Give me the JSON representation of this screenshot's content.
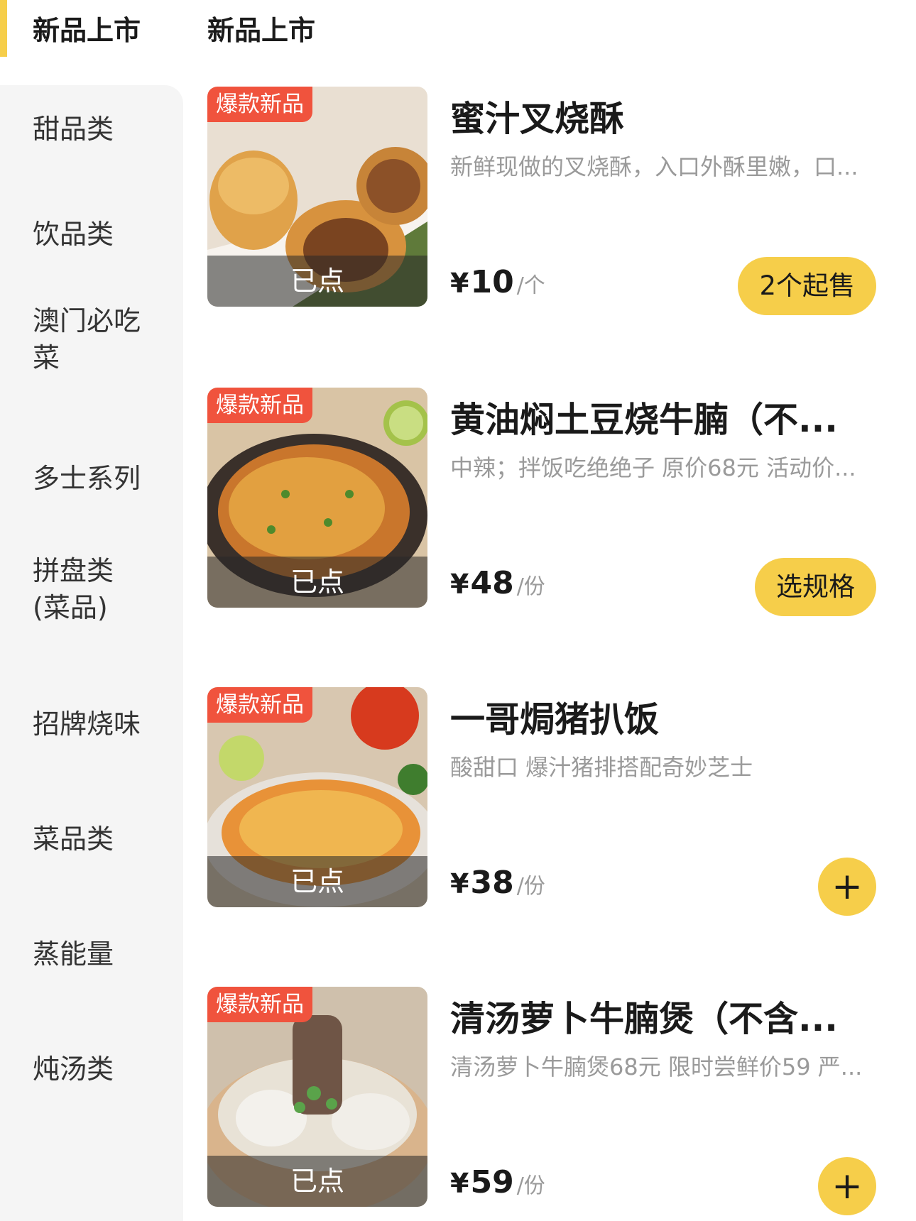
{
  "sidebar": {
    "active": "新品上市",
    "items": [
      {
        "label": "甜品类"
      },
      {
        "label": "饮品类"
      },
      {
        "label": "澳门必吃菜"
      },
      {
        "label": "多士系列"
      },
      {
        "label": "拼盘类(菜品)"
      },
      {
        "label": "招牌烧味"
      },
      {
        "label": "菜品类"
      },
      {
        "label": "蒸能量"
      },
      {
        "label": "炖汤类"
      }
    ]
  },
  "section": {
    "title": "新品上市"
  },
  "products": [
    {
      "badge": "爆款新品",
      "ordered": "已点",
      "name": "蜜汁叉烧酥",
      "desc": "新鲜现做的叉烧酥，入口外酥里嫩，口...",
      "currency": "¥",
      "price": "10",
      "unit": "/个",
      "action": "2个起售",
      "image": "char-siu-pastry"
    },
    {
      "badge": "爆款新品",
      "ordered": "已点",
      "name": "黄油焖土豆烧牛腩（不...",
      "desc": "中辣；拌饭吃绝绝子 原价68元 活动价...",
      "currency": "¥",
      "price": "48",
      "unit": "/份",
      "action": "选规格",
      "image": "beef-potato-claypot"
    },
    {
      "badge": "爆款新品",
      "ordered": "已点",
      "name": "一哥焗猪扒饭",
      "desc": "酸甜口 爆汁猪排搭配奇妙芝士",
      "currency": "¥",
      "price": "38",
      "unit": "/份",
      "action": "+",
      "image": "baked-pork-chop-rice"
    },
    {
      "badge": "爆款新品",
      "ordered": "已点",
      "name": "清汤萝卜牛腩煲（不含...",
      "desc": "清汤萝卜牛腩煲68元 限时尝鲜价59 严...",
      "currency": "¥",
      "price": "59",
      "unit": "/份",
      "action": "+",
      "image": "radish-beef-soup"
    }
  ],
  "colors": {
    "accent": "#f6ce4a",
    "badge": "#f0533d",
    "sidebar_bg": "#f5f5f5"
  }
}
